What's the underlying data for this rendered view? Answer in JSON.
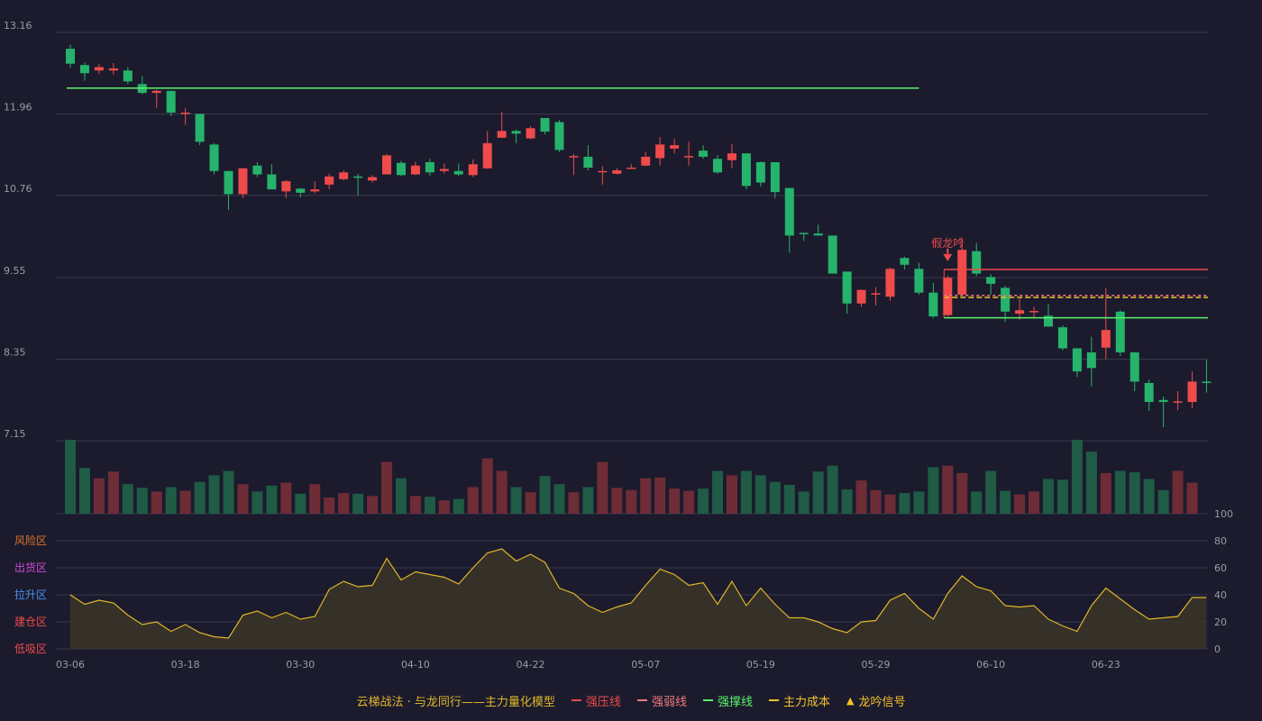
{
  "colors": {
    "background": "#1b1b2d",
    "up": "#ef4b4b",
    "down": "#26b36b",
    "grid": "#3a3a4e",
    "resistance": "#ef4b4b",
    "weak": "#f07a7a",
    "support": "#5bf26a",
    "cost": "#f5c22a",
    "oscillator": "#e0b52a",
    "signal": "#ef4b4b"
  },
  "chart_data": {
    "type": "candlestick",
    "price_axis": {
      "ticks": [
        "13.16",
        "11.96",
        "10.76",
        "9.55",
        "8.35",
        "7.15"
      ],
      "ylim": [
        7.15,
        13.16
      ]
    },
    "x_ticks": [
      {
        "index": 0,
        "label": "03-06"
      },
      {
        "index": 8,
        "label": "03-18"
      },
      {
        "index": 16,
        "label": "03-30"
      },
      {
        "index": 24,
        "label": "04-10"
      },
      {
        "index": 32,
        "label": "04-22"
      },
      {
        "index": 40,
        "label": "05-07"
      },
      {
        "index": 48,
        "label": "05-19"
      },
      {
        "index": 56,
        "label": "05-29"
      },
      {
        "index": 64,
        "label": "06-10"
      },
      {
        "index": 72,
        "label": "06-23"
      }
    ],
    "candles": [
      [
        12.92,
        12.7,
        12.98,
        12.64
      ],
      [
        12.68,
        12.56,
        12.72,
        12.45
      ],
      [
        12.6,
        12.65,
        12.7,
        12.55
      ],
      [
        12.6,
        12.63,
        12.71,
        12.54
      ],
      [
        12.6,
        12.44,
        12.65,
        12.4
      ],
      [
        12.4,
        12.27,
        12.52,
        12.25
      ],
      [
        12.27,
        12.3,
        12.32,
        12.05
      ],
      [
        12.3,
        11.98,
        12.3,
        11.93
      ],
      [
        11.96,
        11.98,
        12.05,
        11.8
      ],
      [
        11.96,
        11.55,
        11.96,
        11.5
      ],
      [
        11.51,
        11.12,
        11.53,
        11.07
      ],
      [
        11.12,
        10.78,
        11.12,
        10.55
      ],
      [
        10.78,
        11.16,
        11.16,
        10.72
      ],
      [
        11.2,
        11.07,
        11.25,
        11.03
      ],
      [
        11.07,
        10.85,
        11.22,
        10.85
      ],
      [
        10.82,
        10.97,
        10.99,
        10.72
      ],
      [
        10.86,
        10.8,
        10.87,
        10.73
      ],
      [
        10.82,
        10.85,
        10.97,
        10.79
      ],
      [
        10.92,
        11.04,
        11.08,
        10.85
      ],
      [
        11.0,
        11.1,
        11.13,
        10.98
      ],
      [
        11.04,
        11.02,
        11.08,
        10.76
      ],
      [
        10.98,
        11.03,
        11.06,
        10.95
      ],
      [
        11.07,
        11.35,
        11.37,
        11.07
      ],
      [
        11.24,
        11.06,
        11.27,
        11.05
      ],
      [
        11.07,
        11.2,
        11.26,
        11.06
      ],
      [
        11.25,
        11.1,
        11.3,
        11.05
      ],
      [
        11.12,
        11.15,
        11.23,
        11.08
      ],
      [
        11.12,
        11.07,
        11.23,
        11.05
      ],
      [
        11.06,
        11.22,
        11.29,
        11.03
      ],
      [
        11.16,
        11.53,
        11.71,
        11.15
      ],
      [
        11.61,
        11.71,
        11.99,
        11.61
      ],
      [
        11.71,
        11.67,
        11.73,
        11.53
      ],
      [
        11.6,
        11.75,
        11.78,
        11.59
      ],
      [
        11.9,
        11.7,
        11.9,
        11.66
      ],
      [
        11.84,
        11.43,
        11.87,
        11.4
      ],
      [
        11.33,
        11.34,
        11.37,
        11.06
      ],
      [
        11.33,
        11.17,
        11.5,
        11.13
      ],
      [
        11.12,
        11.12,
        11.19,
        10.92
      ],
      [
        11.08,
        11.13,
        11.16,
        11.07
      ],
      [
        11.16,
        11.17,
        11.22,
        11.15
      ],
      [
        11.2,
        11.33,
        11.4,
        11.19
      ],
      [
        11.31,
        11.51,
        11.62,
        11.2
      ],
      [
        11.45,
        11.5,
        11.59,
        11.38
      ],
      [
        11.34,
        11.34,
        11.55,
        11.2
      ],
      [
        11.42,
        11.33,
        11.5,
        11.3
      ],
      [
        11.3,
        11.1,
        11.35,
        11.08
      ],
      [
        11.28,
        11.38,
        11.52,
        11.16
      ],
      [
        11.38,
        10.9,
        11.38,
        10.85
      ],
      [
        11.25,
        10.95,
        11.26,
        10.89
      ],
      [
        11.25,
        10.81,
        11.25,
        10.72
      ],
      [
        10.87,
        10.17,
        10.87,
        9.92
      ],
      [
        10.21,
        10.2,
        10.21,
        10.09
      ],
      [
        10.2,
        10.17,
        10.33,
        10.17
      ],
      [
        10.17,
        9.61,
        10.17,
        9.61
      ],
      [
        9.64,
        9.17,
        9.64,
        9.02
      ],
      [
        9.17,
        9.37,
        9.37,
        9.12
      ],
      [
        9.32,
        9.32,
        9.41,
        9.14
      ],
      [
        9.27,
        9.68,
        9.7,
        9.21
      ],
      [
        9.84,
        9.74,
        9.86,
        9.67
      ],
      [
        9.68,
        9.33,
        9.77,
        9.3
      ],
      [
        9.33,
        8.98,
        9.47,
        8.95
      ],
      [
        9.0,
        9.55,
        9.58,
        8.98
      ],
      [
        9.3,
        9.96,
        10.14,
        9.28
      ],
      [
        9.94,
        9.61,
        10.06,
        9.57
      ],
      [
        9.56,
        9.46,
        9.6,
        9.3
      ],
      [
        9.4,
        9.05,
        9.43,
        8.9
      ],
      [
        9.02,
        9.07,
        9.24,
        8.93
      ],
      [
        9.06,
        9.06,
        9.12,
        8.95
      ],
      [
        8.99,
        8.83,
        9.16,
        8.83
      ],
      [
        8.82,
        8.51,
        8.85,
        8.48
      ],
      [
        8.51,
        8.17,
        8.51,
        8.09
      ],
      [
        8.45,
        8.22,
        8.68,
        7.95
      ],
      [
        8.52,
        8.78,
        9.4,
        8.35
      ],
      [
        9.05,
        8.45,
        9.07,
        8.4
      ],
      [
        8.45,
        8.02,
        8.46,
        7.88
      ],
      [
        8.0,
        7.72,
        8.05,
        7.59
      ],
      [
        7.75,
        7.72,
        7.8,
        7.35
      ],
      [
        7.73,
        7.73,
        7.88,
        7.6
      ],
      [
        7.72,
        8.02,
        8.17,
        7.63
      ],
      [
        8.02,
        8.0,
        8.34,
        7.86
      ]
    ],
    "volume": [
      100,
      62,
      48,
      57,
      40,
      35,
      30,
      36,
      31,
      43,
      52,
      58,
      40,
      30,
      38,
      42,
      27,
      40,
      22,
      28,
      27,
      24,
      70,
      48,
      24,
      23,
      18,
      20,
      36,
      75,
      58,
      36,
      29,
      51,
      40,
      29,
      36,
      70,
      35,
      32,
      48,
      49,
      34,
      31,
      34,
      58,
      52,
      58,
      52,
      43,
      39,
      30,
      57,
      65,
      33,
      45,
      32,
      26,
      28,
      30,
      63,
      65,
      55,
      30,
      58,
      31,
      26,
      30,
      47,
      46,
      100,
      84,
      55,
      58,
      56,
      47,
      32,
      58,
      42
    ],
    "oscillator": {
      "ylim": [
        0,
        100
      ],
      "ticks": [
        "100",
        "80",
        "60",
        "40",
        "20",
        "0"
      ],
      "zones": [
        "风险区",
        "出货区",
        "拉升区",
        "建仓区",
        "低吸区"
      ],
      "values": [
        40,
        33,
        36,
        34,
        25,
        18,
        20,
        13,
        18,
        12,
        9,
        8,
        25,
        28,
        23,
        27,
        22,
        24,
        44,
        50,
        46,
        47,
        67,
        51,
        57,
        55,
        53,
        48,
        60,
        71,
        74,
        65,
        70,
        64,
        45,
        41,
        32,
        27,
        31,
        34,
        47,
        59,
        55,
        47,
        49,
        33,
        50,
        32,
        45,
        33,
        23,
        23,
        20,
        15,
        12,
        20,
        21,
        36,
        41,
        30,
        22,
        41,
        54,
        46,
        43,
        32,
        31,
        32,
        22,
        17,
        13,
        32,
        45,
        37,
        29,
        22,
        23,
        24,
        38,
        38
      ]
    },
    "overlays": {
      "top_line": {
        "price": 12.34,
        "start": 0,
        "end": 59
      },
      "resistance": {
        "price": 9.67,
        "start": 61,
        "end": 79
      },
      "weak": {
        "price": 9.29,
        "start": 61,
        "end": 79
      },
      "cost": {
        "price": 9.26,
        "start": 61,
        "end": 79
      },
      "support": {
        "price": 8.96,
        "start": 61,
        "end": 79
      }
    },
    "signal": {
      "index": 61,
      "label": "假龙吟"
    }
  },
  "legend": {
    "title": "云梯战法 · 与龙同行——主力量化模型",
    "items": [
      "强压线",
      "强弱线",
      "强撑线",
      "主力成本",
      "龙吟信号"
    ]
  }
}
